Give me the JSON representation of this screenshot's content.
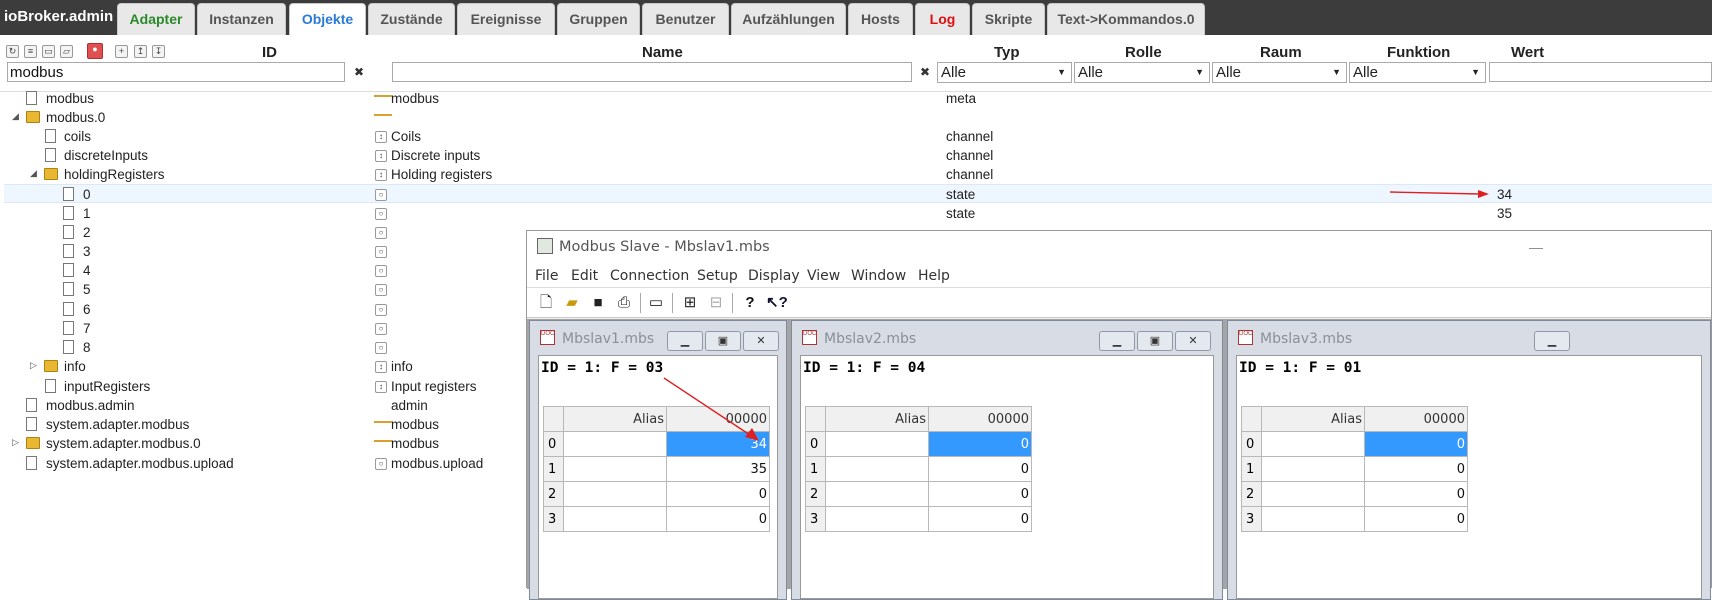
{
  "app": {
    "title": "ioBroker.admin"
  },
  "tabs": [
    {
      "label": "Adapter",
      "color": "#2a8a2a"
    },
    {
      "label": "Instanzen",
      "color": "#555555"
    },
    {
      "label": "Objekte",
      "color": "#2a7ad8",
      "active": true
    },
    {
      "label": "Zustände",
      "color": "#555555"
    },
    {
      "label": "Ereignisse",
      "color": "#555555"
    },
    {
      "label": "Gruppen",
      "color": "#555555"
    },
    {
      "label": "Benutzer",
      "color": "#555555"
    },
    {
      "label": "Aufzählungen",
      "color": "#555555"
    },
    {
      "label": "Hosts",
      "color": "#555555"
    },
    {
      "label": "Log",
      "color": "#dd1111"
    },
    {
      "label": "Skripte",
      "color": "#555555"
    },
    {
      "label": "Text->Kommandos.0",
      "color": "#555555"
    }
  ],
  "columns": {
    "id": "ID",
    "name": "Name",
    "typ": "Typ",
    "rolle": "Rolle",
    "raum": "Raum",
    "funktion": "Funktion",
    "wert": "Wert"
  },
  "filters": {
    "id_value": "modbus",
    "name_value": "",
    "typ": "Alle",
    "rolle": "Alle",
    "raum": "Alle",
    "funktion": "Alle",
    "clear_symbol": "✖"
  },
  "tree": [
    {
      "id": "modbus",
      "name": "modbus",
      "type": "meta",
      "value": ""
    },
    {
      "id": "modbus.0",
      "name": "",
      "type": "",
      "value": ""
    },
    {
      "id": "coils",
      "name": "Coils",
      "type": "channel",
      "value": ""
    },
    {
      "id": "discreteInputs",
      "name": "Discrete inputs",
      "type": "channel",
      "value": ""
    },
    {
      "id": "holdingRegisters",
      "name": "Holding registers",
      "type": "channel",
      "value": ""
    },
    {
      "id": "0",
      "name": "",
      "type": "state",
      "value": "34"
    },
    {
      "id": "1",
      "name": "",
      "type": "state",
      "value": "35"
    },
    {
      "id": "2",
      "name": "",
      "type": "",
      "value": ""
    },
    {
      "id": "3",
      "name": "",
      "type": "",
      "value": ""
    },
    {
      "id": "4",
      "name": "",
      "type": "",
      "value": ""
    },
    {
      "id": "5",
      "name": "",
      "type": "",
      "value": ""
    },
    {
      "id": "6",
      "name": "",
      "type": "",
      "value": ""
    },
    {
      "id": "7",
      "name": "",
      "type": "",
      "value": ""
    },
    {
      "id": "8",
      "name": "",
      "type": "",
      "value": ""
    },
    {
      "id": "info",
      "name": "info",
      "type": "",
      "value": ""
    },
    {
      "id": "inputRegisters",
      "name": "Input registers",
      "type": "",
      "value": ""
    },
    {
      "id": "modbus.admin",
      "name": "admin",
      "type": "",
      "value": ""
    },
    {
      "id": "system.adapter.modbus",
      "name": "modbus",
      "type": "",
      "value": ""
    },
    {
      "id": "system.adapter.modbus.0",
      "name": "modbus",
      "type": "",
      "value": ""
    },
    {
      "id": "system.adapter.modbus.upload",
      "name": "modbus.upload",
      "type": "",
      "value": ""
    }
  ],
  "modbus_slave": {
    "title": "Modbus Slave - Mbslav1.mbs",
    "minimize": "—",
    "menu": [
      "File",
      "Edit",
      "Connection",
      "Setup",
      "Display",
      "View",
      "Window",
      "Help"
    ],
    "windows": [
      {
        "name": "Mbslav1.mbs",
        "header": "ID = 1: F = 03",
        "alias_label": "Alias",
        "address_label": "00000",
        "rows": [
          {
            "idx": "0",
            "value": "34"
          },
          {
            "idx": "1",
            "value": "35"
          },
          {
            "idx": "2",
            "value": "0"
          },
          {
            "idx": "3",
            "value": "0"
          }
        ]
      },
      {
        "name": "Mbslav2.mbs",
        "header": "ID = 1: F = 04",
        "alias_label": "Alias",
        "address_label": "00000",
        "rows": [
          {
            "idx": "0",
            "value": "0"
          },
          {
            "idx": "1",
            "value": "0"
          },
          {
            "idx": "2",
            "value": "0"
          },
          {
            "idx": "3",
            "value": "0"
          }
        ]
      },
      {
        "name": "Mbslav3.mbs",
        "header": "ID = 1: F = 01",
        "alias_label": "Alias",
        "address_label": "00000",
        "rows": [
          {
            "idx": "0",
            "value": "0"
          },
          {
            "idx": "1",
            "value": "0"
          },
          {
            "idx": "2",
            "value": "0"
          },
          {
            "idx": "3",
            "value": "0"
          }
        ]
      }
    ]
  },
  "annotation_color": "#e02020"
}
